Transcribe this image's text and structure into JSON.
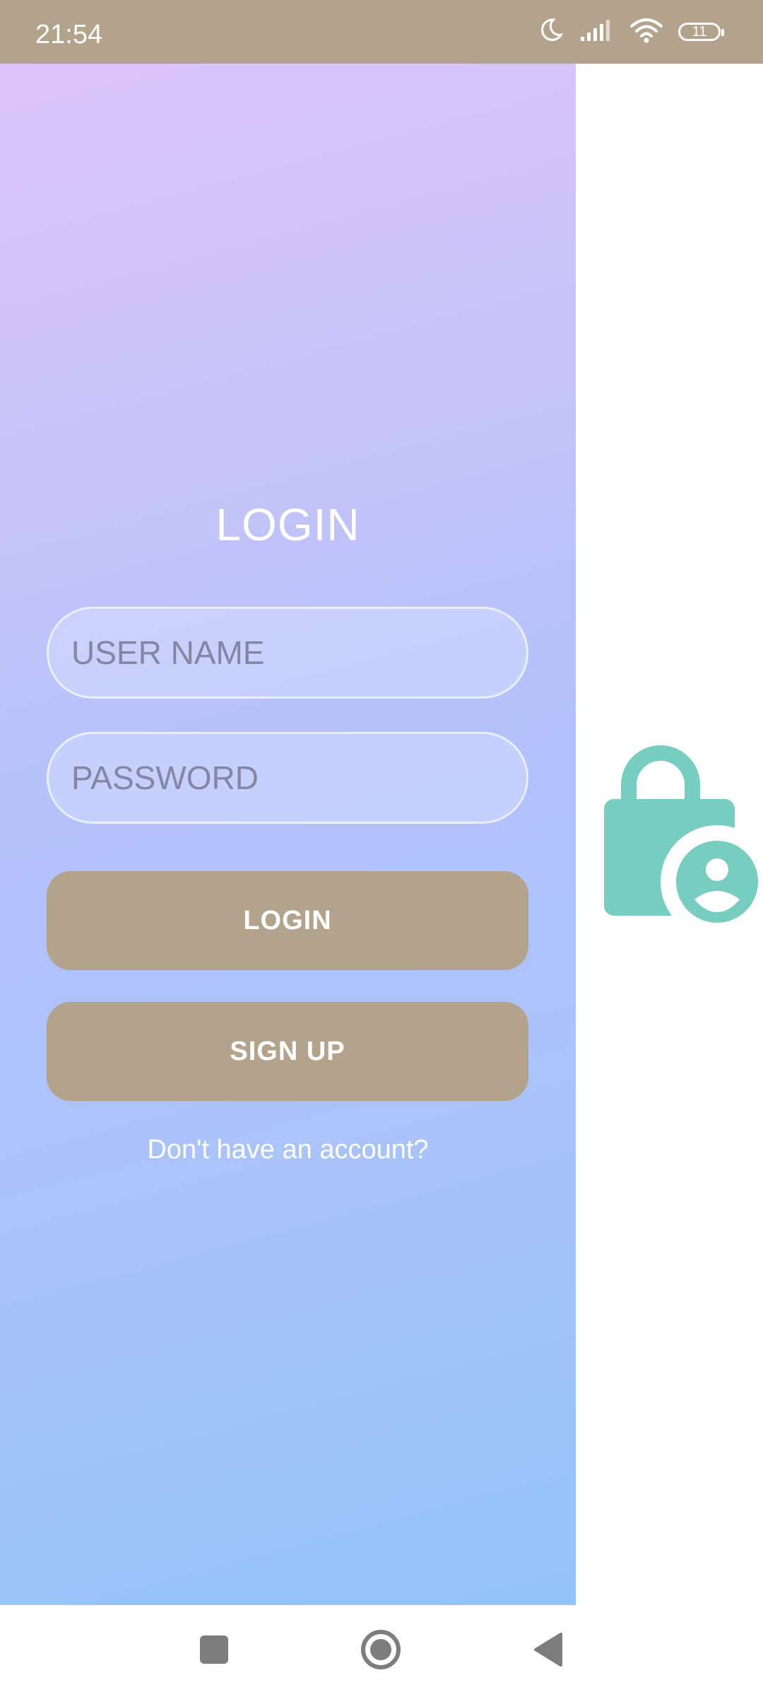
{
  "status_bar": {
    "time": "21:54",
    "icons": [
      "moon-icon",
      "signal-icon",
      "wifi-icon",
      "battery-icon"
    ],
    "battery_level": "11",
    "background_color": "#b3a38d"
  },
  "login": {
    "title": "LOGIN",
    "username": {
      "value": "",
      "placeholder": "USER NAME"
    },
    "password": {
      "value": "",
      "placeholder": "PASSWORD"
    },
    "login_button_label": "LOGIN",
    "signup_button_label": "SIGN UP",
    "hint_text": "Don't have an account?",
    "button_color": "#b3a38d",
    "gradient_colors": [
      "#dcc4fa",
      "#c6c4f9",
      "#b2c1fa",
      "#93c3fa"
    ]
  },
  "illustration": {
    "icon": "lock-user-icon",
    "color": "#76cdc0"
  },
  "nav_bar": {
    "buttons": [
      "recents-icon",
      "home-icon",
      "back-icon"
    ]
  }
}
